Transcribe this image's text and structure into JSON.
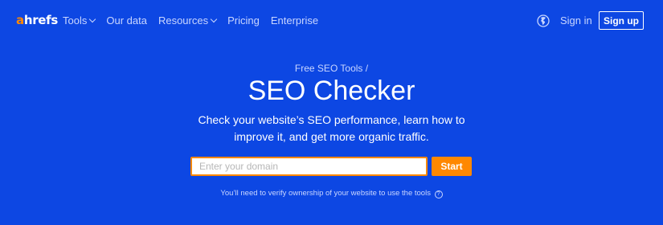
{
  "header": {
    "logo": {
      "first_letter": "a",
      "rest": "hrefs"
    },
    "nav": [
      {
        "label": "Tools",
        "has_dropdown": true
      },
      {
        "label": "Our data",
        "has_dropdown": false
      },
      {
        "label": "Resources",
        "has_dropdown": true
      },
      {
        "label": "Pricing",
        "has_dropdown": false
      },
      {
        "label": "Enterprise",
        "has_dropdown": false
      }
    ],
    "language_icon": "globe-icon",
    "signin_label": "Sign in",
    "signup_label": "Sign up"
  },
  "hero": {
    "breadcrumb": "Free SEO Tools /",
    "title": "SEO Checker",
    "subtitle_line1": "Check your website’s SEO performance, learn how to",
    "subtitle_line2": "improve it, and get more organic traffic.",
    "search": {
      "placeholder": "Enter your domain",
      "value": ""
    },
    "start_label": "Start",
    "note": "You’ll need to verify ownership of your website to use the tools",
    "help_icon_glyph": "?"
  },
  "colors": {
    "background": "#0d47e3",
    "accent": "#ff8800",
    "muted_text": "#c9d6ff",
    "text": "#ffffff"
  }
}
